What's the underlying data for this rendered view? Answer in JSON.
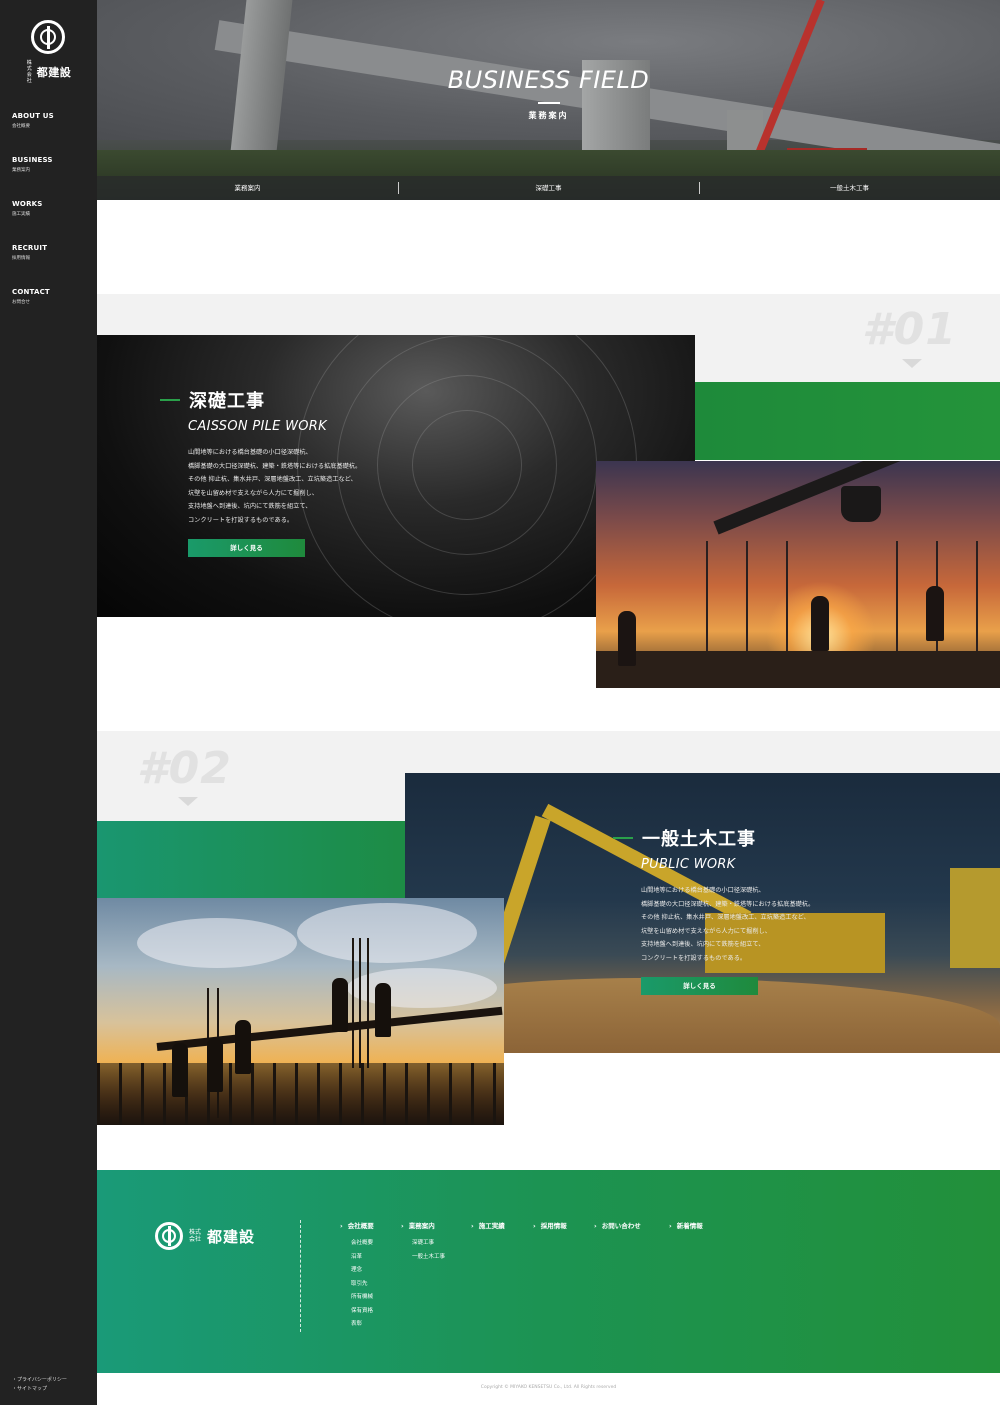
{
  "brand": {
    "name": "都建設",
    "prefix": "株式会社"
  },
  "sidebar": {
    "items": [
      {
        "en": "ABOUT US",
        "ja": "会社概要"
      },
      {
        "en": "BUSINESS",
        "ja": "業務案内"
      },
      {
        "en": "WORKS",
        "ja": "施工実績"
      },
      {
        "en": "RECRUIT",
        "ja": "採用情報"
      },
      {
        "en": "CONTACT",
        "ja": "お問合せ"
      }
    ],
    "links": [
      "・プライバシーポリシー",
      "・サイトマップ"
    ]
  },
  "hero": {
    "title_en": "BUSINESS FIELD",
    "title_ja": "業務案内",
    "tabs": [
      "業務案内",
      "深礎工事",
      "一般土木工事"
    ]
  },
  "sections": [
    {
      "number": "#01",
      "title_ja": "深礎工事",
      "title_en": "CAISSON PILE WORK",
      "desc": [
        "山間地等における橋台基礎の小口径深礎杭、",
        "橋脚基礎の大口径深礎杭、建築・鉄塔等における拡底基礎杭。",
        "その他 抑止杭、集水井戸、深層地盤改工、立坑築造工など、",
        "坑壁を山留め材で支えながら人力にて掘削し、",
        "支持地盤へ到達後、坑内にて鉄筋を組立て、",
        "コンクリートを打設するものである。"
      ],
      "button": "詳しく見る"
    },
    {
      "number": "#02",
      "title_ja": "一般土木工事",
      "title_en": "PUBLIC WORK",
      "desc": [
        "山間地等における橋台基礎の小口径深礎杭、",
        "橋脚基礎の大口径深礎杭、建築・鉄塔等における拡底基礎杭。",
        "その他 抑止杭、集水井戸、深層地盤改工、立坑築造工など、",
        "坑壁を山留め材で支えながら人力にて掘削し、",
        "支持地盤へ到達後、坑内にて鉄筋を組立て、",
        "コンクリートを打設するものである。"
      ],
      "button": "詳しく見る"
    }
  ],
  "footer": {
    "columns": [
      {
        "head": "会社概要",
        "items": [
          "会社概要",
          "沿革",
          "理念",
          "取引先",
          "所有機械",
          "保有資格",
          "表彰"
        ]
      },
      {
        "head": "業務案内",
        "items": [
          "深礎工事",
          "一般土木工事"
        ]
      },
      {
        "head": "施工実績",
        "items": []
      },
      {
        "head": "採用情報",
        "items": []
      },
      {
        "head": "お問い合わせ",
        "items": []
      },
      {
        "head": "新着情報",
        "items": []
      }
    ],
    "copyright": "Copyright © MIYAKO KENSETSU Co., Ltd. All Rights reserved"
  },
  "colors": {
    "sidebar": "#222222",
    "accent_green": "#1f8a3c",
    "accent_teal": "#1a9a78"
  }
}
